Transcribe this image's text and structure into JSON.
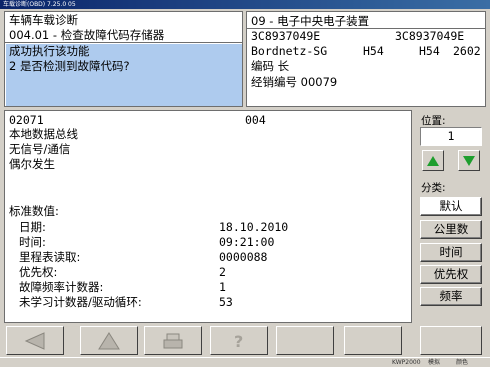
{
  "window": {
    "title": "车载诊断(OBD) 7.25.0 05"
  },
  "left_header": {
    "title": "车辆车载诊断",
    "function": "004.01 - 检查故障代码存储器",
    "message_line1": "成功执行该功能",
    "message_line2": "2 是否检测到故障代码?"
  },
  "right_header": {
    "address": "09 - 电子中央电子装置",
    "part_no_1": "3C8937049E",
    "part_no_2": "3C8937049E",
    "component": "Bordnetz-SG",
    "version_1": "H54",
    "version_2": "H54",
    "version_3": "2602",
    "coding_label": "编码 长",
    "dealer_label": "经销编号 00079"
  },
  "fault": {
    "code": "02071",
    "number": "004",
    "line1": "本地数据总线",
    "line2": "无信号/通信",
    "line3": "偶尔发生"
  },
  "freeze": {
    "heading": "标准数值:",
    "rows": [
      {
        "label": "日期:",
        "value": "18.10.2010"
      },
      {
        "label": "时间:",
        "value": "09:21:00"
      },
      {
        "label": "里程表读取:",
        "value": "0000088"
      },
      {
        "label": "优先权:",
        "value": "2"
      },
      {
        "label": "故障频率计数器:",
        "value": "1"
      },
      {
        "label": "未学习计数器/驱动循环:",
        "value": "53"
      }
    ]
  },
  "sidebar": {
    "position_label": "位置:",
    "position_value": "1",
    "category_label": "分类:",
    "buttons": [
      "默认",
      "公里数",
      "时间",
      "优先权",
      "频率"
    ]
  },
  "statusbar": {
    "left": "KWP2000",
    "mid": "模拟",
    "right": "颜色"
  },
  "colors": {
    "arrow_green": "#1e9e2e",
    "selection": "#aecbee"
  }
}
